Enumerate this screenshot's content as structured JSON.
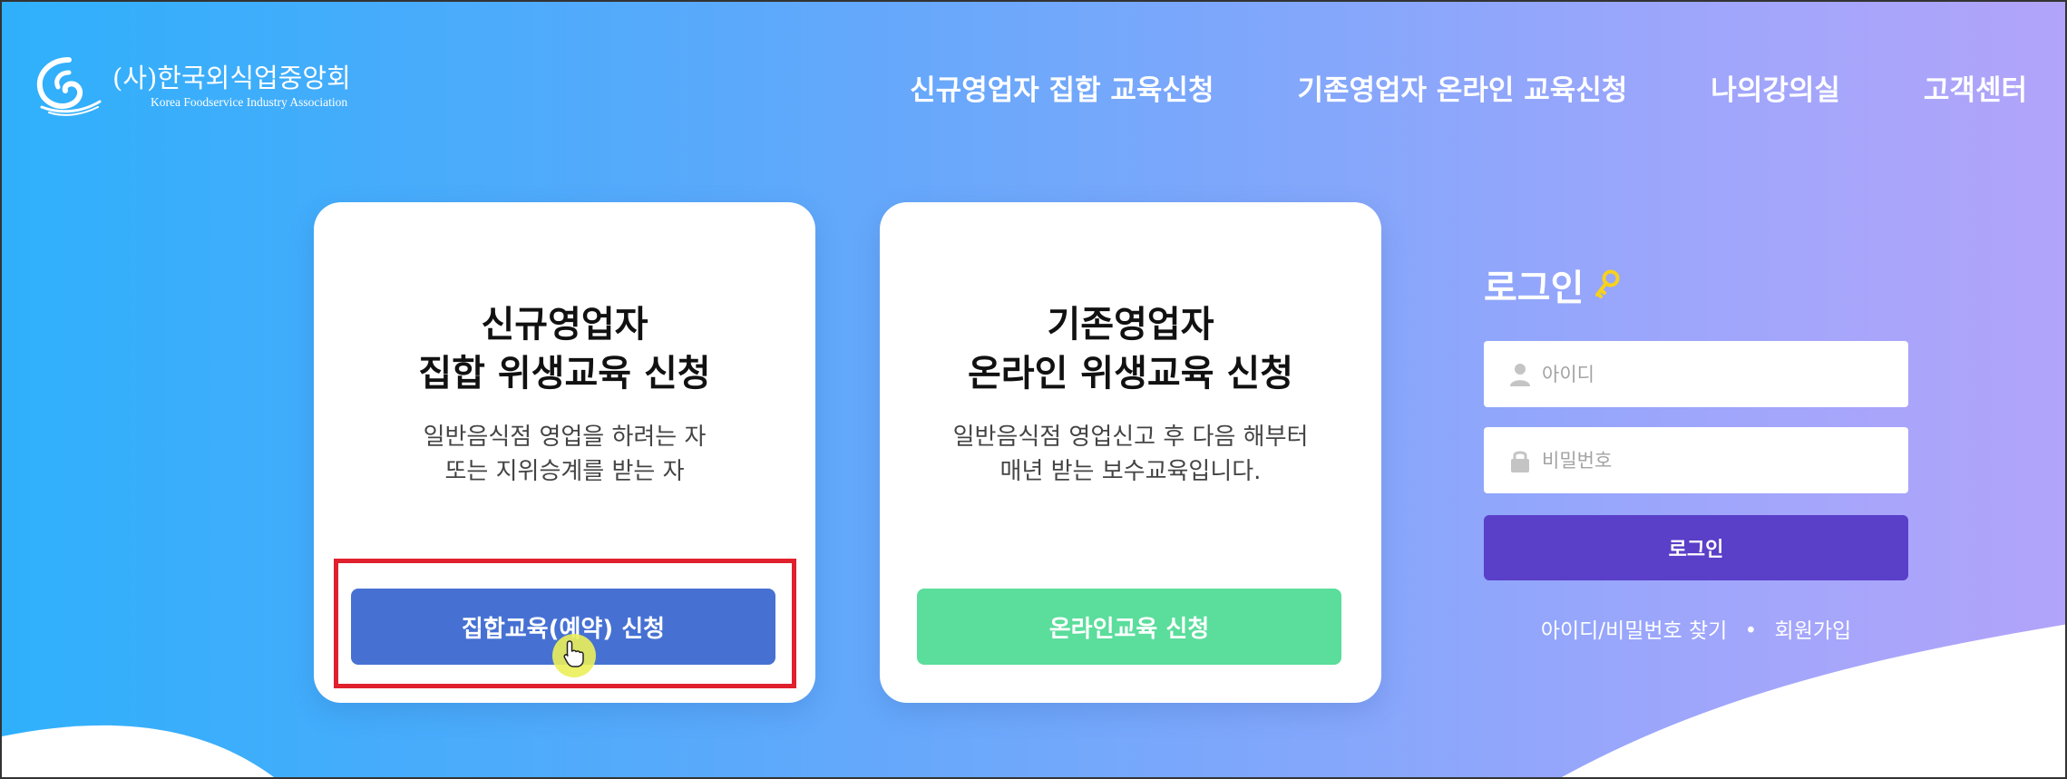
{
  "brand": {
    "name_ko": "(사)한국외식업중앙회",
    "name_en": "Korea Foodservice Industry Association"
  },
  "nav": {
    "items": [
      {
        "label": "신규영업자 집합 교육신청"
      },
      {
        "label": "기존영업자 온라인 교육신청"
      },
      {
        "label": "나의강의실"
      },
      {
        "label": "고객센터"
      }
    ]
  },
  "cards": [
    {
      "title_line1": "신규영업자",
      "title_line2": "집합 위생교육 신청",
      "desc_line1": "일반음식점 영업을 하려는 자",
      "desc_line2": "또는 지위승계를 받는 자",
      "button_label": "집합교육(예약) 신청",
      "button_color": "#4671d3"
    },
    {
      "title_line1": "기존영업자",
      "title_line2": "온라인 위생교육 신청",
      "desc_line1": "일반음식점 영업신고 후 다음 해부터",
      "desc_line2": "매년 받는 보수교육입니다.",
      "button_label": "온라인교육 신청",
      "button_color": "#5bdd9c"
    }
  ],
  "login": {
    "title": "로그인",
    "id_placeholder": "아이디",
    "pw_placeholder": "비밀번호",
    "button_label": "로그인",
    "find_link": "아이디/비밀번호 찾기",
    "separator": "•",
    "signup_link": "회원가입",
    "button_color": "#5a3fc8"
  },
  "colors": {
    "gradient_start": "#2fb0fb",
    "gradient_end": "#b1a4fa",
    "highlight_border": "#e0202d"
  }
}
